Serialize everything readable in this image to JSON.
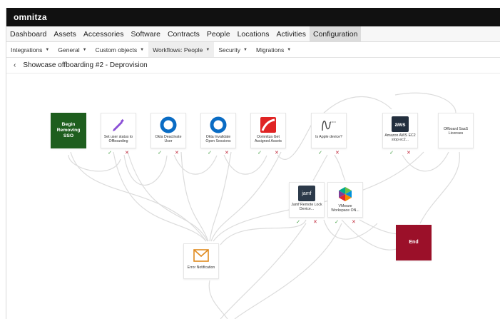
{
  "app": {
    "logo": "omnitza"
  },
  "main_nav": [
    {
      "label": "Dashboard"
    },
    {
      "label": "Assets"
    },
    {
      "label": "Accessories"
    },
    {
      "label": "Software"
    },
    {
      "label": "Contracts"
    },
    {
      "label": "People"
    },
    {
      "label": "Locations"
    },
    {
      "label": "Activities"
    },
    {
      "label": "Configuration",
      "active": true
    }
  ],
  "sub_nav": [
    {
      "label": "Integrations"
    },
    {
      "label": "General"
    },
    {
      "label": "Custom objects"
    },
    {
      "label": "Workflows: People",
      "active": true
    },
    {
      "label": "Security"
    },
    {
      "label": "Migrations"
    }
  ],
  "page": {
    "back_icon": "chevron-left-icon",
    "title": "Showcase offboarding #2 - Deprovision"
  },
  "marks": {
    "ok": "✓",
    "no": "✕"
  },
  "nodes": {
    "begin": {
      "label": "Begin Removing SSO",
      "color": "#1e5e1e"
    },
    "set_user": {
      "label": "Set user status to Offboarding",
      "icon": "pencil-icon"
    },
    "okta_deactivate": {
      "label": "Okta Deactivate User",
      "icon": "okta-icon"
    },
    "okta_invalidate": {
      "label": "Okta Invalidate Open Sessions",
      "icon": "okta-icon"
    },
    "oomnitza_get": {
      "label": "Oomnitza Get Assigned Assets",
      "icon": "oomnitza-icon"
    },
    "is_apple": {
      "label": "Is Apple device?",
      "icon": "branch-condition-icon"
    },
    "aws": {
      "label": "Amazon AWS EC2 stop ec2...",
      "icon": "aws-icon",
      "icon_text": "aws"
    },
    "offboard_saas": {
      "label": "Offboard SaaS Licenses"
    },
    "jamf": {
      "label": "Jamf Remote Lock Device...",
      "icon": "jamf-icon",
      "icon_text": "jamf"
    },
    "vmware": {
      "label": "VMware Workspace ON...",
      "icon": "vmware-icon"
    },
    "end": {
      "label": "End",
      "color": "#9b1029"
    },
    "error": {
      "label": "Error Notification",
      "icon": "envelope-icon"
    }
  }
}
